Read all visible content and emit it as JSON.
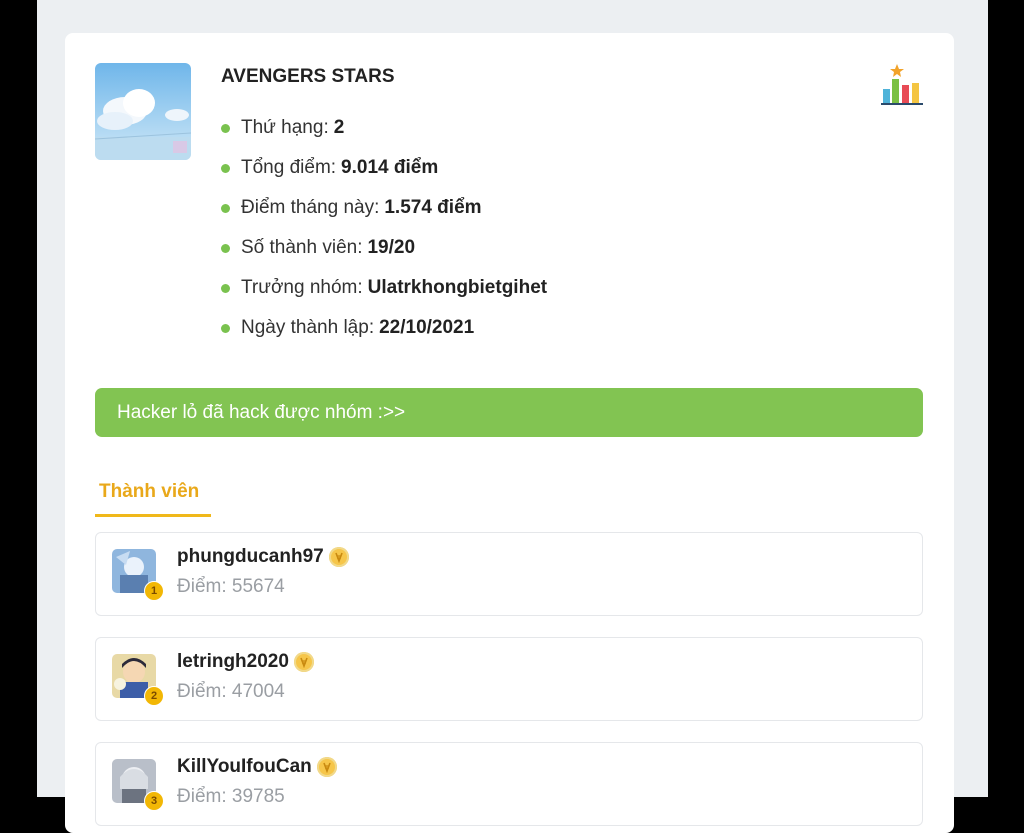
{
  "group": {
    "name": "AVENGERS STARS",
    "info": [
      {
        "label": "Thứ hạng:",
        "value": "2"
      },
      {
        "label": "Tổng điểm:",
        "value": "9.014 điểm"
      },
      {
        "label": "Điểm tháng này:",
        "value": "1.574 điểm"
      },
      {
        "label": "Số thành viên:",
        "value": "19/20"
      },
      {
        "label": "Trưởng nhóm:",
        "value": "Ulatrkhongbietgihet"
      },
      {
        "label": "Ngày thành lập:",
        "value": "22/10/2021"
      }
    ]
  },
  "banner": "Hacker lỏ đã hack được nhóm :>>",
  "tab": "Thành viên",
  "members": [
    {
      "name": "phungducanh97",
      "score": "Điểm: 55674",
      "rank": "1"
    },
    {
      "name": "letringh2020",
      "score": "Điểm: 47004",
      "rank": "2"
    },
    {
      "name": "KillYouIfouCan",
      "score": "Điểm: 39785",
      "rank": "3"
    }
  ],
  "colors": {
    "accent_green": "#82c452",
    "tab_yellow": "#e9a81a",
    "dot_green": "#7ac24f"
  },
  "icons": {
    "ranking_chart": "bar-chart-star-icon",
    "medal": "medal-icon"
  }
}
